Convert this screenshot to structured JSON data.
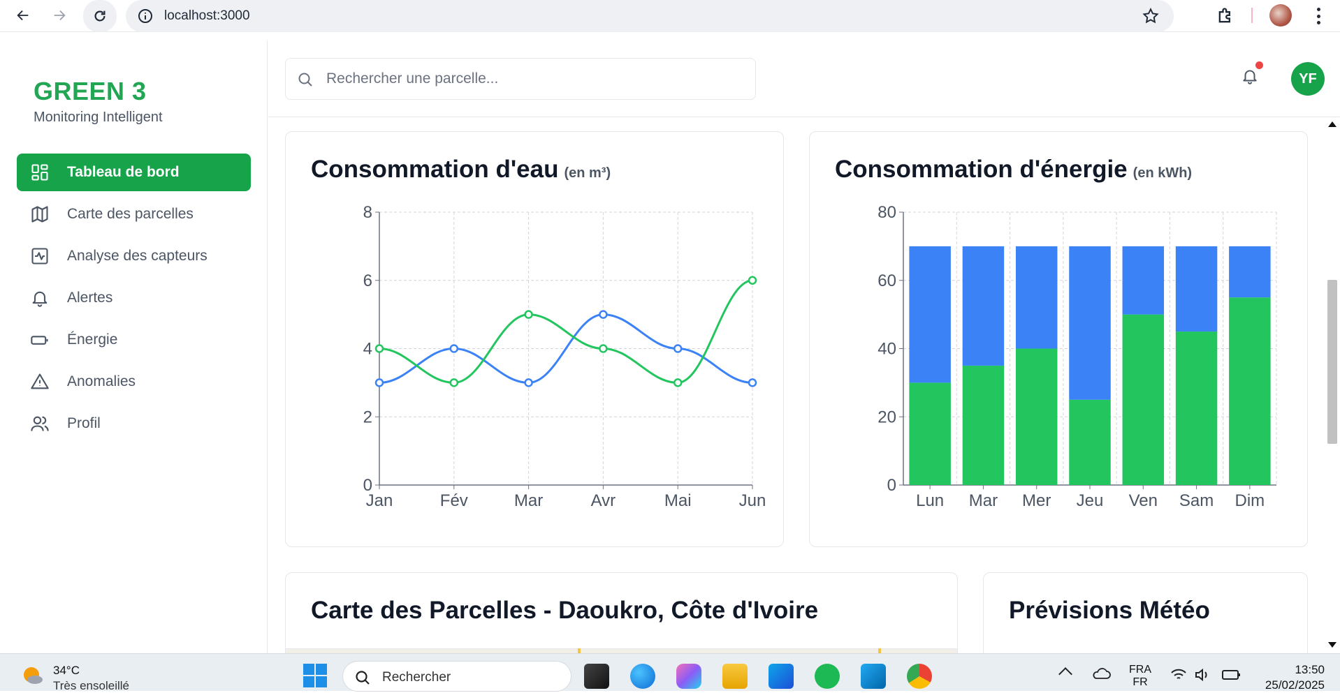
{
  "browser": {
    "url": "localhost:3000"
  },
  "sidebar": {
    "brand": "GREEN 3",
    "subtitle": "Monitoring Intelligent",
    "items": [
      {
        "label": "Tableau de bord",
        "icon": "dashboard-icon",
        "active": true
      },
      {
        "label": "Carte des parcelles",
        "icon": "map-icon",
        "active": false
      },
      {
        "label": "Analyse des capteurs",
        "icon": "activity-icon",
        "active": false
      },
      {
        "label": "Alertes",
        "icon": "bell-icon",
        "active": false
      },
      {
        "label": "Énergie",
        "icon": "battery-icon",
        "active": false
      },
      {
        "label": "Anomalies",
        "icon": "warning-icon",
        "active": false
      },
      {
        "label": "Profil",
        "icon": "users-icon",
        "active": false
      }
    ]
  },
  "header": {
    "search_placeholder": "Rechercher une parcelle...",
    "avatar_initials": "YF",
    "notification_dot": true
  },
  "cards": {
    "water": {
      "title": "Consommation d'eau",
      "unit": "(en m³)"
    },
    "energy": {
      "title": "Consommation d'énergie",
      "unit": "(en kWh)"
    },
    "map": {
      "title": "Carte des Parcelles - Daoukro, Côte d'Ivoire"
    },
    "weather": {
      "title": "Prévisions Météo"
    }
  },
  "chart_data": [
    {
      "type": "line",
      "categories": [
        "Jan",
        "Fév",
        "Mar",
        "Avr",
        "Mai",
        "Jun"
      ],
      "series": [
        {
          "color": "#3b82f6",
          "values": [
            3,
            4,
            3,
            5,
            4,
            3
          ]
        },
        {
          "color": "#22c55e",
          "values": [
            4,
            3,
            5,
            4,
            3,
            6
          ]
        }
      ],
      "ylim": [
        0,
        8
      ],
      "yticks": [
        0,
        2,
        4,
        6,
        8
      ],
      "grid": true
    },
    {
      "type": "bar",
      "stacked": true,
      "categories": [
        "Lun",
        "Mar",
        "Mer",
        "Jeu",
        "Ven",
        "Sam",
        "Dim"
      ],
      "series": [
        {
          "color": "#22c55e",
          "values": [
            30,
            35,
            40,
            25,
            50,
            45,
            55
          ]
        },
        {
          "color": "#3b82f6",
          "values": [
            40,
            35,
            30,
            45,
            20,
            25,
            15
          ]
        }
      ],
      "ylim": [
        0,
        80
      ],
      "yticks": [
        0,
        20,
        40,
        60,
        80
      ],
      "grid": true
    }
  ],
  "taskbar": {
    "weather_temp": "34°C",
    "weather_desc": "Très ensoleillé",
    "search_label": "Rechercher",
    "lang_line1": "FRA",
    "lang_line2": "FR",
    "time": "13:50",
    "date": "25/02/2025"
  }
}
